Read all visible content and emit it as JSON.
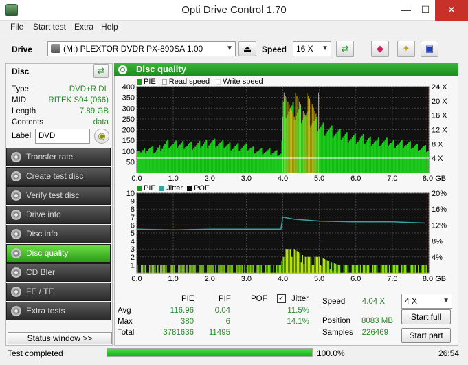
{
  "window": {
    "title": "Opti Drive Control 1.70"
  },
  "menu": [
    "File",
    "Start test",
    "Extra",
    "Help"
  ],
  "toolbar": {
    "drive_label": "Drive",
    "drive_value": "(M:)  PLEXTOR DVDR   PX-890SA 1.00",
    "speed_label": "Speed",
    "speed_value": "16 X"
  },
  "disc": {
    "header": "Disc",
    "rows": [
      {
        "label": "Type",
        "value": "DVD+R DL"
      },
      {
        "label": "MID",
        "value": "RITEK S04 (066)"
      },
      {
        "label": "Length",
        "value": "7.89 GB"
      },
      {
        "label": "Contents",
        "value": "data"
      }
    ],
    "label_label": "Label",
    "label_value": "DVD"
  },
  "nav": [
    {
      "label": "Transfer rate",
      "selected": false
    },
    {
      "label": "Create test disc",
      "selected": false
    },
    {
      "label": "Verify test disc",
      "selected": false
    },
    {
      "label": "Drive info",
      "selected": false
    },
    {
      "label": "Disc info",
      "selected": false
    },
    {
      "label": "Disc quality",
      "selected": true
    },
    {
      "label": "CD Bler",
      "selected": false
    },
    {
      "label": "FE / TE",
      "selected": false
    },
    {
      "label": "Extra tests",
      "selected": false
    }
  ],
  "status_window_label": "Status window >>",
  "panel_title": "Disc quality",
  "legend_top": [
    "PIE",
    "Read speed",
    "Write speed"
  ],
  "legend_bottom": [
    "PIF",
    "Jitter",
    "POF"
  ],
  "stats": {
    "headers": [
      "PIE",
      "PIF",
      "POF",
      "Jitter"
    ],
    "jitter_checked": true,
    "rows": [
      {
        "label": "Avg",
        "pie": "116.96",
        "pif": "0.04",
        "pof": "",
        "jitter": "11.5%"
      },
      {
        "label": "Max",
        "pie": "380",
        "pif": "6",
        "pof": "",
        "jitter": "14.1%"
      },
      {
        "label": "Total",
        "pie": "3781636",
        "pif": "11495",
        "pof": "",
        "jitter": ""
      }
    ]
  },
  "info": {
    "speed_label": "Speed",
    "speed_value": "4.04 X",
    "position_label": "Position",
    "position_value": "8083 MB",
    "samples_label": "Samples",
    "samples_value": "226469"
  },
  "test_speed": "4 X",
  "buttons": {
    "start_full": "Start full",
    "start_part": "Start part"
  },
  "status": {
    "text": "Test completed",
    "progress_text": "100.0%",
    "progress": 1.0,
    "time": "26:54"
  },
  "colors": {
    "pie": "#1ec81e",
    "read_speed": "#ffffff",
    "pif": "#8cd81e",
    "jitter": "#3aa0a0",
    "pof": "#101010",
    "spike": "#d0b020"
  },
  "chart_data": [
    {
      "type": "area",
      "name": "PIE / speed",
      "x_ticks": [
        "0.0",
        "1.0",
        "2.0",
        "3.0",
        "4.0",
        "5.0",
        "6.0",
        "7.0",
        "8.0 GB"
      ],
      "y_ticks_left": [
        "400",
        "350",
        "300",
        "250",
        "200",
        "150",
        "100",
        "50"
      ],
      "y_ticks_right": [
        "24 X",
        "20 X",
        "16 X",
        "12 X",
        "8 X",
        "4 X"
      ],
      "xlim": [
        0,
        8.0
      ],
      "ylim": [
        0,
        400
      ],
      "series": [
        {
          "name": "PIE",
          "x": [
            0,
            0.1,
            0.3,
            0.5,
            0.8,
            1.0,
            1.3,
            1.6,
            2.0,
            2.3,
            2.6,
            3.0,
            3.3,
            3.6,
            3.95,
            4.0,
            4.2,
            4.5,
            4.8,
            5.0,
            5.3,
            5.6,
            6.0,
            6.3,
            6.6,
            7.0,
            7.3,
            7.6,
            7.9
          ],
          "y": [
            120,
            90,
            110,
            100,
            135,
            125,
            130,
            120,
            140,
            130,
            120,
            115,
            100,
            95,
            90,
            300,
            280,
            270,
            230,
            210,
            190,
            170,
            155,
            150,
            140,
            135,
            130,
            120,
            110
          ]
        },
        {
          "name": "Read speed",
          "x": [
            0,
            8.0
          ],
          "y": [
            4.04,
            4.04
          ]
        }
      ]
    },
    {
      "type": "bar",
      "name": "PIF / Jitter",
      "x_ticks": [
        "0.0",
        "1.0",
        "2.0",
        "3.0",
        "4.0",
        "5.0",
        "6.0",
        "7.0",
        "8.0 GB"
      ],
      "y_ticks_left": [
        "10",
        "9",
        "8",
        "7",
        "6",
        "5",
        "4",
        "3",
        "2",
        "1"
      ],
      "y_ticks_right": [
        "20%",
        "16%",
        "12%",
        "8%",
        "4%"
      ],
      "xlim": [
        0,
        8.0
      ],
      "ylim": [
        0,
        10
      ],
      "series": [
        {
          "name": "PIF",
          "x": [
            0,
            0.5,
            1.0,
            1.5,
            2.0,
            2.5,
            3.0,
            3.5,
            3.95,
            4.0,
            4.3,
            4.6,
            5.0,
            5.5,
            6.0,
            6.5,
            7.0,
            7.5,
            7.9
          ],
          "y": [
            1,
            1,
            1,
            1,
            1,
            1,
            1,
            1,
            1,
            3,
            3,
            2,
            2,
            1,
            1,
            1,
            1,
            1,
            1
          ]
        },
        {
          "name": "Jitter",
          "x": [
            0,
            1.0,
            2.0,
            3.0,
            3.95,
            4.0,
            4.3,
            5.0,
            6.0,
            7.0,
            7.9
          ],
          "y": [
            11.0,
            10.8,
            11.0,
            11.0,
            11.0,
            14.0,
            13.5,
            13.0,
            12.8,
            12.8,
            12.5
          ]
        }
      ]
    }
  ]
}
